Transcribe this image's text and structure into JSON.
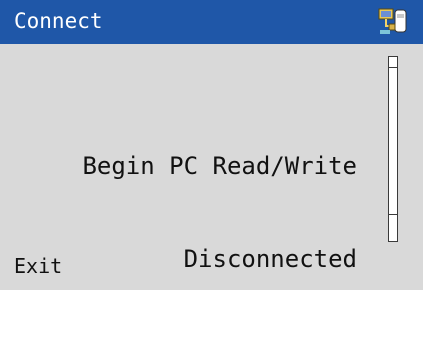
{
  "window": {
    "title": "Connect",
    "title_icon": "pc-device-connection-icon",
    "accent_color": "#1f57a8",
    "background_color": "#d9d9d9"
  },
  "message": {
    "line1": "Begin PC Read/Write",
    "line2": "Disconnected"
  },
  "softkeys": {
    "left_label": "Exit"
  }
}
